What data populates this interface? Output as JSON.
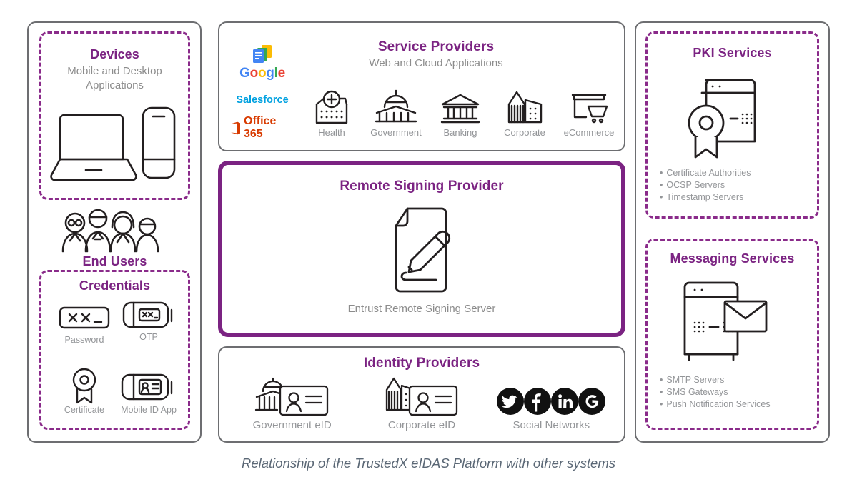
{
  "diagram": {
    "caption": "Relationship of the TrustedX eIDAS Platform with other systems",
    "accent_purple": "#7b2382",
    "dashed_purple": "#8a2b8a",
    "panel_gray": "#6d6e71",
    "label_gray": "#939598"
  },
  "devices": {
    "title": "Devices",
    "subtitle": "Mobile and Desktop Applications",
    "icons": [
      "laptop-icon",
      "smartphone-icon"
    ]
  },
  "end_users": {
    "title": "End Users",
    "icon": "people-group-icon"
  },
  "credentials": {
    "title": "Credentials",
    "items": [
      {
        "label": "Password",
        "icon": "password-field-icon"
      },
      {
        "label": "OTP",
        "icon": "otp-token-icon"
      },
      {
        "label": "Certificate",
        "icon": "certificate-seal-icon"
      },
      {
        "label": "Mobile ID App",
        "icon": "mobile-id-app-icon"
      }
    ]
  },
  "service_providers": {
    "title": "Service Providers",
    "subtitle": "Web and Cloud Applications",
    "logos": [
      {
        "name": "google-logo",
        "text": "Google"
      },
      {
        "name": "salesforce-logo",
        "text": "Salesforce"
      },
      {
        "name": "office365-logo",
        "text": "Office 365"
      }
    ],
    "items": [
      {
        "label": "Health",
        "icon": "health-cross-icon"
      },
      {
        "label": "Government",
        "icon": "government-capitol-icon"
      },
      {
        "label": "Banking",
        "icon": "bank-building-icon"
      },
      {
        "label": "Corporate",
        "icon": "corporate-towers-icon"
      },
      {
        "label": "eCommerce",
        "icon": "shopping-cart-icon"
      }
    ]
  },
  "remote_signing_provider": {
    "title": "Remote Signing Provider",
    "subtitle": "Entrust Remote Signing Server",
    "icon": "document-sign-pencil-icon"
  },
  "identity_providers": {
    "title": "Identity Providers",
    "items": [
      {
        "label": "Government eID",
        "icon": "government-eid-card-icon"
      },
      {
        "label": "Corporate eID",
        "icon": "corporate-eid-card-icon"
      },
      {
        "label": "Social Networks",
        "icon": "social-networks-icon",
        "networks": [
          "twitter-icon",
          "facebook-icon",
          "linkedin-icon",
          "google-plus-icon"
        ]
      }
    ]
  },
  "pki_services": {
    "title": "PKI Services",
    "icon": "server-certificate-icon",
    "bullets": [
      "Certificate Authorities",
      "OCSP Servers",
      "Timestamp Servers"
    ]
  },
  "messaging_services": {
    "title": "Messaging Services",
    "icon": "server-envelope-icon",
    "bullets": [
      "SMTP Servers",
      "SMS Gateways",
      "Push Notification Services"
    ]
  }
}
